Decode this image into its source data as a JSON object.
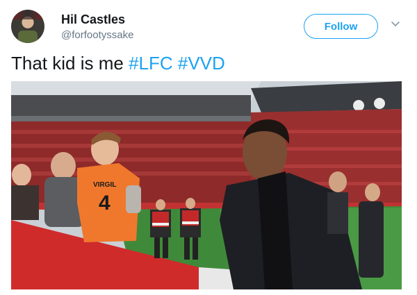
{
  "user": {
    "display_name": "Hil Castles",
    "handle": "@forfootyssake"
  },
  "actions": {
    "follow_label": "Follow"
  },
  "tweet": {
    "text_plain": "That kid is me",
    "hashtags": [
      "#LFC",
      "#VVD"
    ]
  },
  "photo": {
    "shirt_number": "4",
    "shirt_name": "VIRGIL"
  },
  "colors": {
    "accent": "#1da1f2",
    "text": "#14171a",
    "muted": "#657786"
  }
}
